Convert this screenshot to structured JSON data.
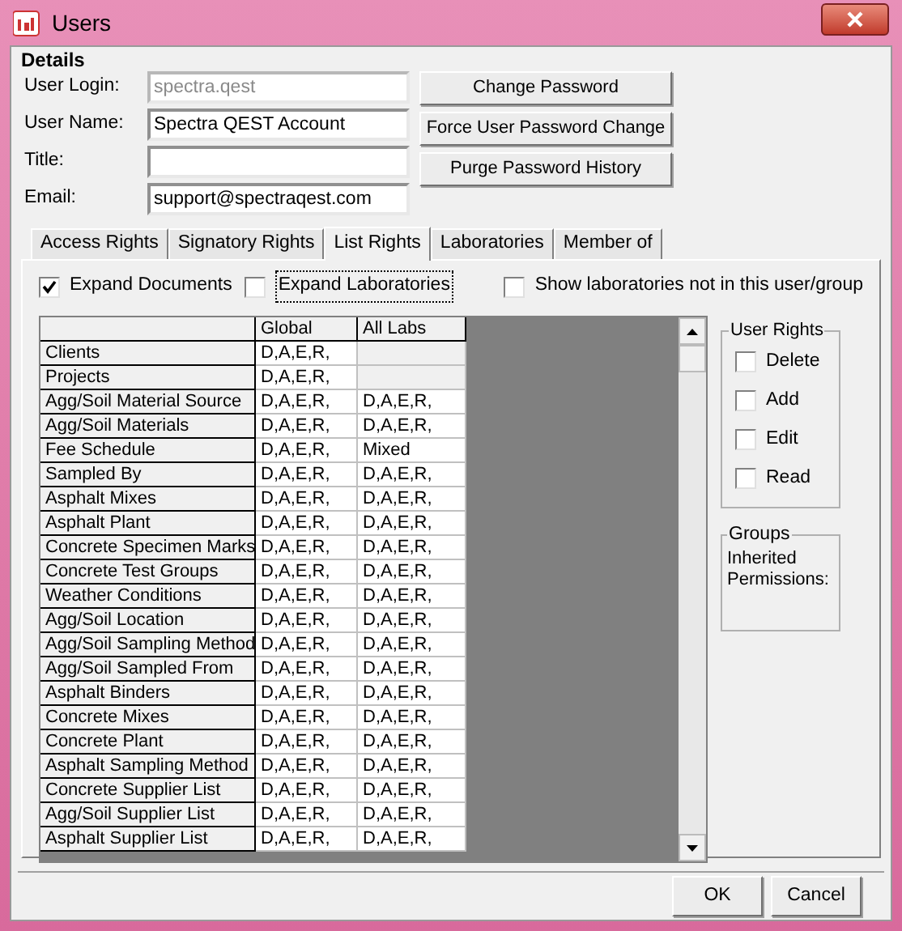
{
  "window": {
    "title": "Users"
  },
  "details": {
    "title": "Details",
    "fields": [
      {
        "label": "User Login:",
        "value": "spectra.qest",
        "disabled": true
      },
      {
        "label": "User Name:",
        "value": "Spectra QEST Account",
        "disabled": false
      },
      {
        "label": "Title:",
        "disabled": false
      },
      {
        "label": "Email:",
        "value": "support@spectraqest.com",
        "disabled": false
      }
    ],
    "buttons": [
      "Change Password",
      "Force User Password Change",
      "Purge Password History"
    ]
  },
  "tabs": [
    {
      "label": "Access Rights",
      "selected": false
    },
    {
      "label": "Signatory Rights",
      "selected": false
    },
    {
      "label": "List Rights",
      "selected": true
    },
    {
      "label": "Laboratories",
      "selected": false
    },
    {
      "label": "Member of",
      "selected": false
    }
  ],
  "options": [
    {
      "label": "Expand Documents",
      "checked": true
    },
    {
      "label": "Expand Laboratories",
      "checked": false
    },
    {
      "label": "Show laboratories not in this user/group",
      "checked": false
    }
  ],
  "table": {
    "columns": [
      "Global",
      "All Labs"
    ],
    "rows": [
      {
        "name": "Clients",
        "global": "D,A,E,R,"
      },
      {
        "name": "Projects",
        "global": "D,A,E,R,"
      },
      {
        "name": "Agg/Soil Material Source",
        "global": "D,A,E,R,",
        "all_labs": "D,A,E,R,"
      },
      {
        "name": "Agg/Soil Materials",
        "global": "D,A,E,R,",
        "all_labs": "D,A,E,R,"
      },
      {
        "name": "Fee Schedule",
        "global": "D,A,E,R,",
        "all_labs": "Mixed"
      },
      {
        "name": "Sampled By",
        "global": "D,A,E,R,",
        "all_labs": "D,A,E,R,"
      },
      {
        "name": "Asphalt Mixes",
        "global": "D,A,E,R,",
        "all_labs": "D,A,E,R,"
      },
      {
        "name": "Asphalt Plant",
        "global": "D,A,E,R,",
        "all_labs": "D,A,E,R,"
      },
      {
        "name": "Concrete Specimen Marks",
        "global": "D,A,E,R,",
        "all_labs": "D,A,E,R,"
      },
      {
        "name": "Concrete Test Groups",
        "global": "D,A,E,R,",
        "all_labs": "D,A,E,R,"
      },
      {
        "name": "Weather Conditions",
        "global": "D,A,E,R,",
        "all_labs": "D,A,E,R,"
      },
      {
        "name": "Agg/Soil Location",
        "global": "D,A,E,R,",
        "all_labs": "D,A,E,R,"
      },
      {
        "name": "Agg/Soil Sampling Method",
        "global": "D,A,E,R,",
        "all_labs": "D,A,E,R,"
      },
      {
        "name": "Agg/Soil Sampled From",
        "global": "D,A,E,R,",
        "all_labs": "D,A,E,R,"
      },
      {
        "name": "Asphalt Binders",
        "global": "D,A,E,R,",
        "all_labs": "D,A,E,R,"
      },
      {
        "name": "Concrete Mixes",
        "global": "D,A,E,R,",
        "all_labs": "D,A,E,R,"
      },
      {
        "name": "Concrete Plant",
        "global": "D,A,E,R,",
        "all_labs": "D,A,E,R,"
      },
      {
        "name": "Asphalt Sampling Method",
        "global": "D,A,E,R,",
        "all_labs": "D,A,E,R,"
      },
      {
        "name": "Concrete Supplier List",
        "global": "D,A,E,R,",
        "all_labs": "D,A,E,R,"
      },
      {
        "name": "Agg/Soil Supplier List",
        "global": "D,A,E,R,",
        "all_labs": "D,A,E,R,"
      },
      {
        "name": "Asphalt Supplier List",
        "global": "D,A,E,R,",
        "all_labs": "D,A,E,R,"
      }
    ]
  },
  "user_rights": {
    "title": "User Rights",
    "items": [
      {
        "label": "Delete",
        "checked": false
      },
      {
        "label": "Add",
        "checked": false
      },
      {
        "label": "Edit",
        "checked": false
      },
      {
        "label": "Read",
        "checked": false
      }
    ]
  },
  "groups": {
    "title": "Groups",
    "text": "Inherited Permissions:"
  },
  "buttons": [
    "OK",
    "Cancel"
  ]
}
